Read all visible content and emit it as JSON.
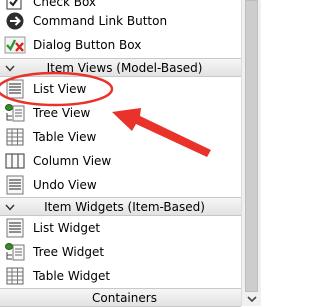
{
  "items": {
    "check_box": "Check Box",
    "command_link_button": "Command Link Button",
    "dialog_button_box": "Dialog Button Box",
    "list_view": "List View",
    "tree_view": "Tree View",
    "table_view": "Table View",
    "column_view": "Column View",
    "undo_view": "Undo View",
    "list_widget": "List Widget",
    "tree_widget": "Tree Widget",
    "table_widget": "Table Widget"
  },
  "categories": {
    "item_views": "Item Views (Model-Based)",
    "item_widgets": "Item Widgets (Item-Based)",
    "containers": "Containers"
  },
  "icons": {
    "check_box": "check-box-icon",
    "command_link_button": "arrow-right-icon",
    "dialog_button_box": "check-cross-icon",
    "list_view": "list-view-icon",
    "tree_view": "tree-view-icon",
    "table_view": "table-icon",
    "column_view": "column-view-icon",
    "undo_view": "undo-list-icon",
    "list_widget": "list-widget-icon",
    "tree_widget": "tree-widget-icon",
    "table_widget": "table-widget-icon"
  },
  "annotation": {
    "color": "#e8322a"
  }
}
